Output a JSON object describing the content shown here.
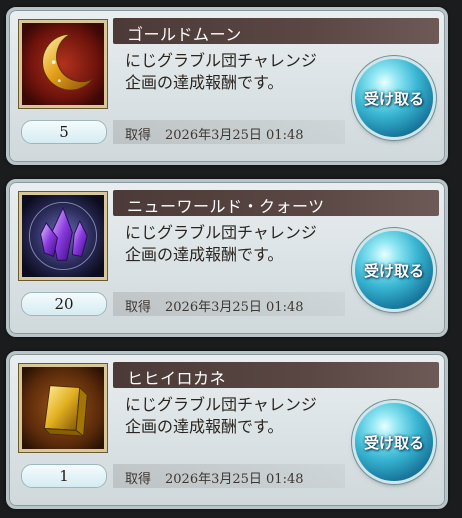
{
  "rewards": [
    {
      "item_name": "ゴールドムーン",
      "description_line1": "にじグラブル団チャレンジ",
      "description_line2": "企画の達成報酬です。",
      "quantity": "5",
      "acquired_label": "取得",
      "acquired_date": "2026年3月25日 01:48",
      "button_label": "受け取る",
      "icon": "gold-moon-icon"
    },
    {
      "item_name": "ニューワールド・クォーツ",
      "description_line1": "にじグラブル団チャレンジ",
      "description_line2": "企画の達成報酬です。",
      "quantity": "20",
      "acquired_label": "取得",
      "acquired_date": "2026年3月25日 01:48",
      "button_label": "受け取る",
      "icon": "purple-crystal-icon"
    },
    {
      "item_name": "ヒヒイロカネ",
      "description_line1": "にじグラブル団チャレンジ",
      "description_line2": "企画の達成報酬です。",
      "quantity": "1",
      "acquired_label": "取得",
      "acquired_date": "2026年3月25日 01:48",
      "button_label": "受け取る",
      "icon": "gold-ingot-icon"
    }
  ],
  "colors": {
    "title_bar": "#4b3a37",
    "button_blue": "#39b6d3",
    "card_bg": "#e9eef0"
  }
}
